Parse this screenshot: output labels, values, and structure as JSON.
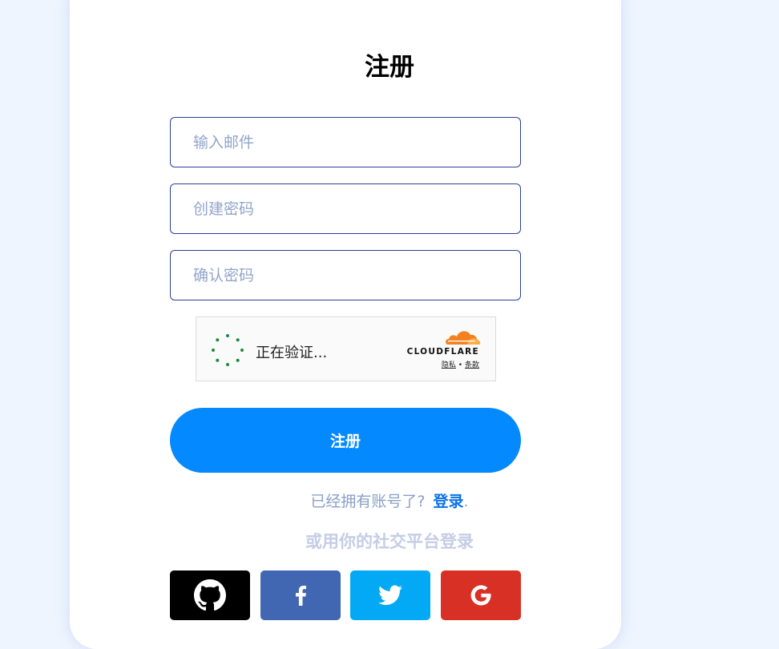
{
  "form": {
    "title": "注册",
    "email_placeholder": "输入邮件",
    "password_placeholder": "创建密码",
    "confirm_placeholder": "确认密码",
    "submit_label": "注册"
  },
  "captcha": {
    "status_text": "正在验证...",
    "brand": "CLOUDFLARE",
    "privacy_link": "隐私",
    "separator": "•",
    "terms_link": "条款"
  },
  "footer": {
    "have_account_text": "已经拥有账号了?",
    "login_link": "登录",
    "trailing": ".",
    "social_title": "或用你的社交平台登录"
  },
  "social_buttons": [
    {
      "icon": "github-icon",
      "color": "#000000"
    },
    {
      "icon": "facebook-icon",
      "color": "#4267b2"
    },
    {
      "icon": "twitter-icon",
      "color": "#03a9f4"
    },
    {
      "icon": "google-icon",
      "color": "#d93025"
    }
  ],
  "colors": {
    "page_bg": "#eef5ff",
    "accent": "#0489ff",
    "input_border": "#2d3f99",
    "link": "#0a72e6",
    "cloudflare_orange": "#f48120"
  }
}
